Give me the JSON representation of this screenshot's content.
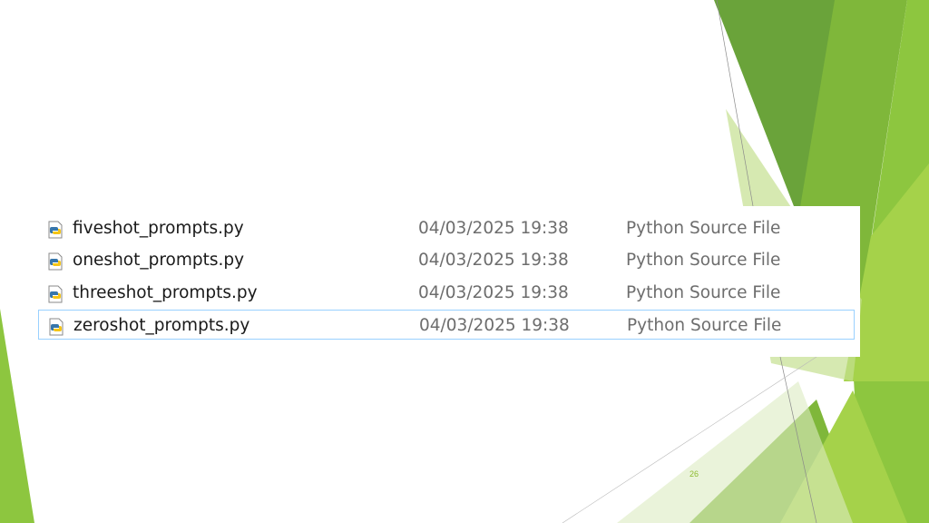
{
  "slide": {
    "number": "26",
    "accent_colors": [
      "#8dc63f",
      "#6aa33a",
      "#a5d24a",
      "#c5e090"
    ]
  },
  "files": [
    {
      "name": "fiveshot_prompts.py",
      "date": "04/03/2025 19:38",
      "type": "Python Source File",
      "icon": "python-file-icon",
      "selected": false
    },
    {
      "name": "oneshot_prompts.py",
      "date": "04/03/2025 19:38",
      "type": "Python Source File",
      "icon": "python-file-icon",
      "selected": false
    },
    {
      "name": "threeshot_prompts.py",
      "date": "04/03/2025 19:38",
      "type": "Python Source File",
      "icon": "python-file-icon",
      "selected": false
    },
    {
      "name": "zeroshot_prompts.py",
      "date": "04/03/2025 19:38",
      "type": "Python Source File",
      "icon": "python-file-icon",
      "selected": true
    }
  ]
}
